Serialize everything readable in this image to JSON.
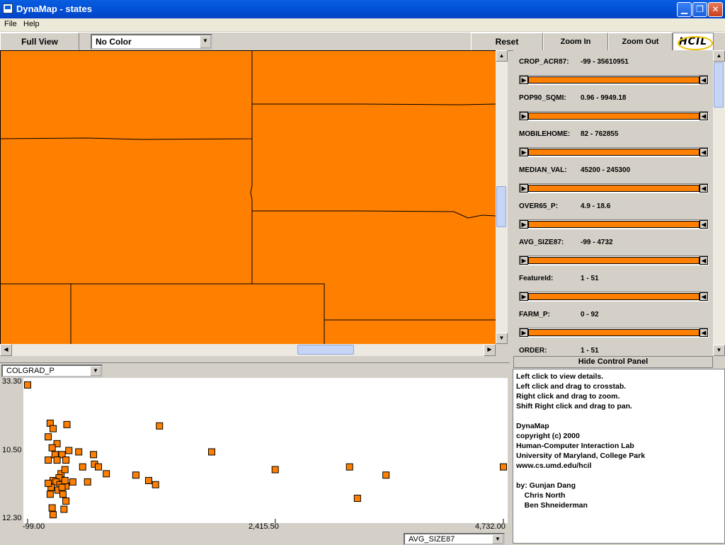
{
  "window": {
    "title": "DynaMap - states"
  },
  "menu": {
    "file": "File",
    "help": "Help"
  },
  "toolbar": {
    "full_view": "Full View",
    "color_select": "No Color",
    "reset": "Reset",
    "zoom_in": "Zoom In",
    "zoom_out": "Zoom Out",
    "logo": "HCIL"
  },
  "colors": {
    "map_fill": "#ff8000",
    "accent": "#ff8000",
    "panel": "#d4d0c8"
  },
  "control_panel": {
    "attributes": [
      {
        "name": "CROP_ACR87:",
        "range": "-99 - 35610951"
      },
      {
        "name": "POP90_SQMI:",
        "range": "0.96 - 9949.18"
      },
      {
        "name": "MOBILEHOME:",
        "range": "82 - 762855"
      },
      {
        "name": "MEDIAN_VAL:",
        "range": "45200 - 245300"
      },
      {
        "name": "OVER65_P:",
        "range": "4.9 - 18.6"
      },
      {
        "name": "AVG_SIZE87:",
        "range": "-99 - 4732"
      },
      {
        "name": "FeatureId:",
        "range": "1 - 51"
      },
      {
        "name": "FARM_P:",
        "range": "0 - 92"
      },
      {
        "name": "ORDER:",
        "range": "1 - 51"
      }
    ],
    "hide_label": "Hide Control Panel"
  },
  "scatter": {
    "y_select": "COLGRAD_P",
    "x_select": "AVG_SIZE87",
    "y_ticks": [
      "33.30",
      "10.50",
      "12.30"
    ],
    "x_ticks": [
      "-99.00",
      "2,415.50",
      "4,732.00"
    ]
  },
  "chart_data": {
    "type": "scatter",
    "xlabel": "AVG_SIZE87",
    "ylabel": "COLGRAD_P",
    "x_tick_labels": [
      "-99.00",
      "2,415.50",
      "4,732.00"
    ],
    "y_tick_labels": [
      "33.30",
      "10.50",
      "12.30"
    ],
    "xlim": [
      -99,
      4732
    ],
    "ylim": [
      0,
      1
    ],
    "marker_color": "#ff8000",
    "points": [
      [
        -99,
        0.98
      ],
      [
        130,
        0.7
      ],
      [
        160,
        0.66
      ],
      [
        300,
        0.69
      ],
      [
        1240,
        0.68
      ],
      [
        110,
        0.6
      ],
      [
        200,
        0.55
      ],
      [
        150,
        0.52
      ],
      [
        180,
        0.47
      ],
      [
        250,
        0.47
      ],
      [
        320,
        0.5
      ],
      [
        420,
        0.49
      ],
      [
        570,
        0.47
      ],
      [
        460,
        0.38
      ],
      [
        290,
        0.43
      ],
      [
        200,
        0.43
      ],
      [
        110,
        0.43
      ],
      [
        580,
        0.4
      ],
      [
        620,
        0.38
      ],
      [
        700,
        0.33
      ],
      [
        240,
        0.33
      ],
      [
        220,
        0.3
      ],
      [
        280,
        0.36
      ],
      [
        160,
        0.28
      ],
      [
        190,
        0.27
      ],
      [
        230,
        0.25
      ],
      [
        290,
        0.24
      ],
      [
        140,
        0.23
      ],
      [
        210,
        0.21
      ],
      [
        250,
        0.23
      ],
      [
        360,
        0.27
      ],
      [
        510,
        0.27
      ],
      [
        1130,
        0.28
      ],
      [
        1200,
        0.25
      ],
      [
        1770,
        0.49
      ],
      [
        2415,
        0.36
      ],
      [
        3170,
        0.38
      ],
      [
        3540,
        0.32
      ],
      [
        4732,
        0.38
      ],
      [
        260,
        0.18
      ],
      [
        290,
        0.13
      ],
      [
        270,
        0.07
      ],
      [
        150,
        0.08
      ],
      [
        130,
        0.18
      ],
      [
        110,
        0.26
      ],
      [
        280,
        0.28
      ],
      [
        3250,
        0.15
      ],
      [
        1000,
        0.32
      ],
      [
        160,
        0.03
      ]
    ]
  },
  "help": {
    "lines": [
      "Left click to view details.",
      "Left click and drag to crosstab.",
      "Right click and drag to zoom.",
      "Shift Right click and drag to pan.",
      "",
      "DynaMap",
      "copyright (c) 2000",
      "Human-Computer Interaction Lab",
      "University of Maryland, College Park",
      "www.cs.umd.edu/hcil",
      "",
      "by: Gunjan Dang",
      "    Chris North",
      "    Ben Shneiderman"
    ]
  }
}
